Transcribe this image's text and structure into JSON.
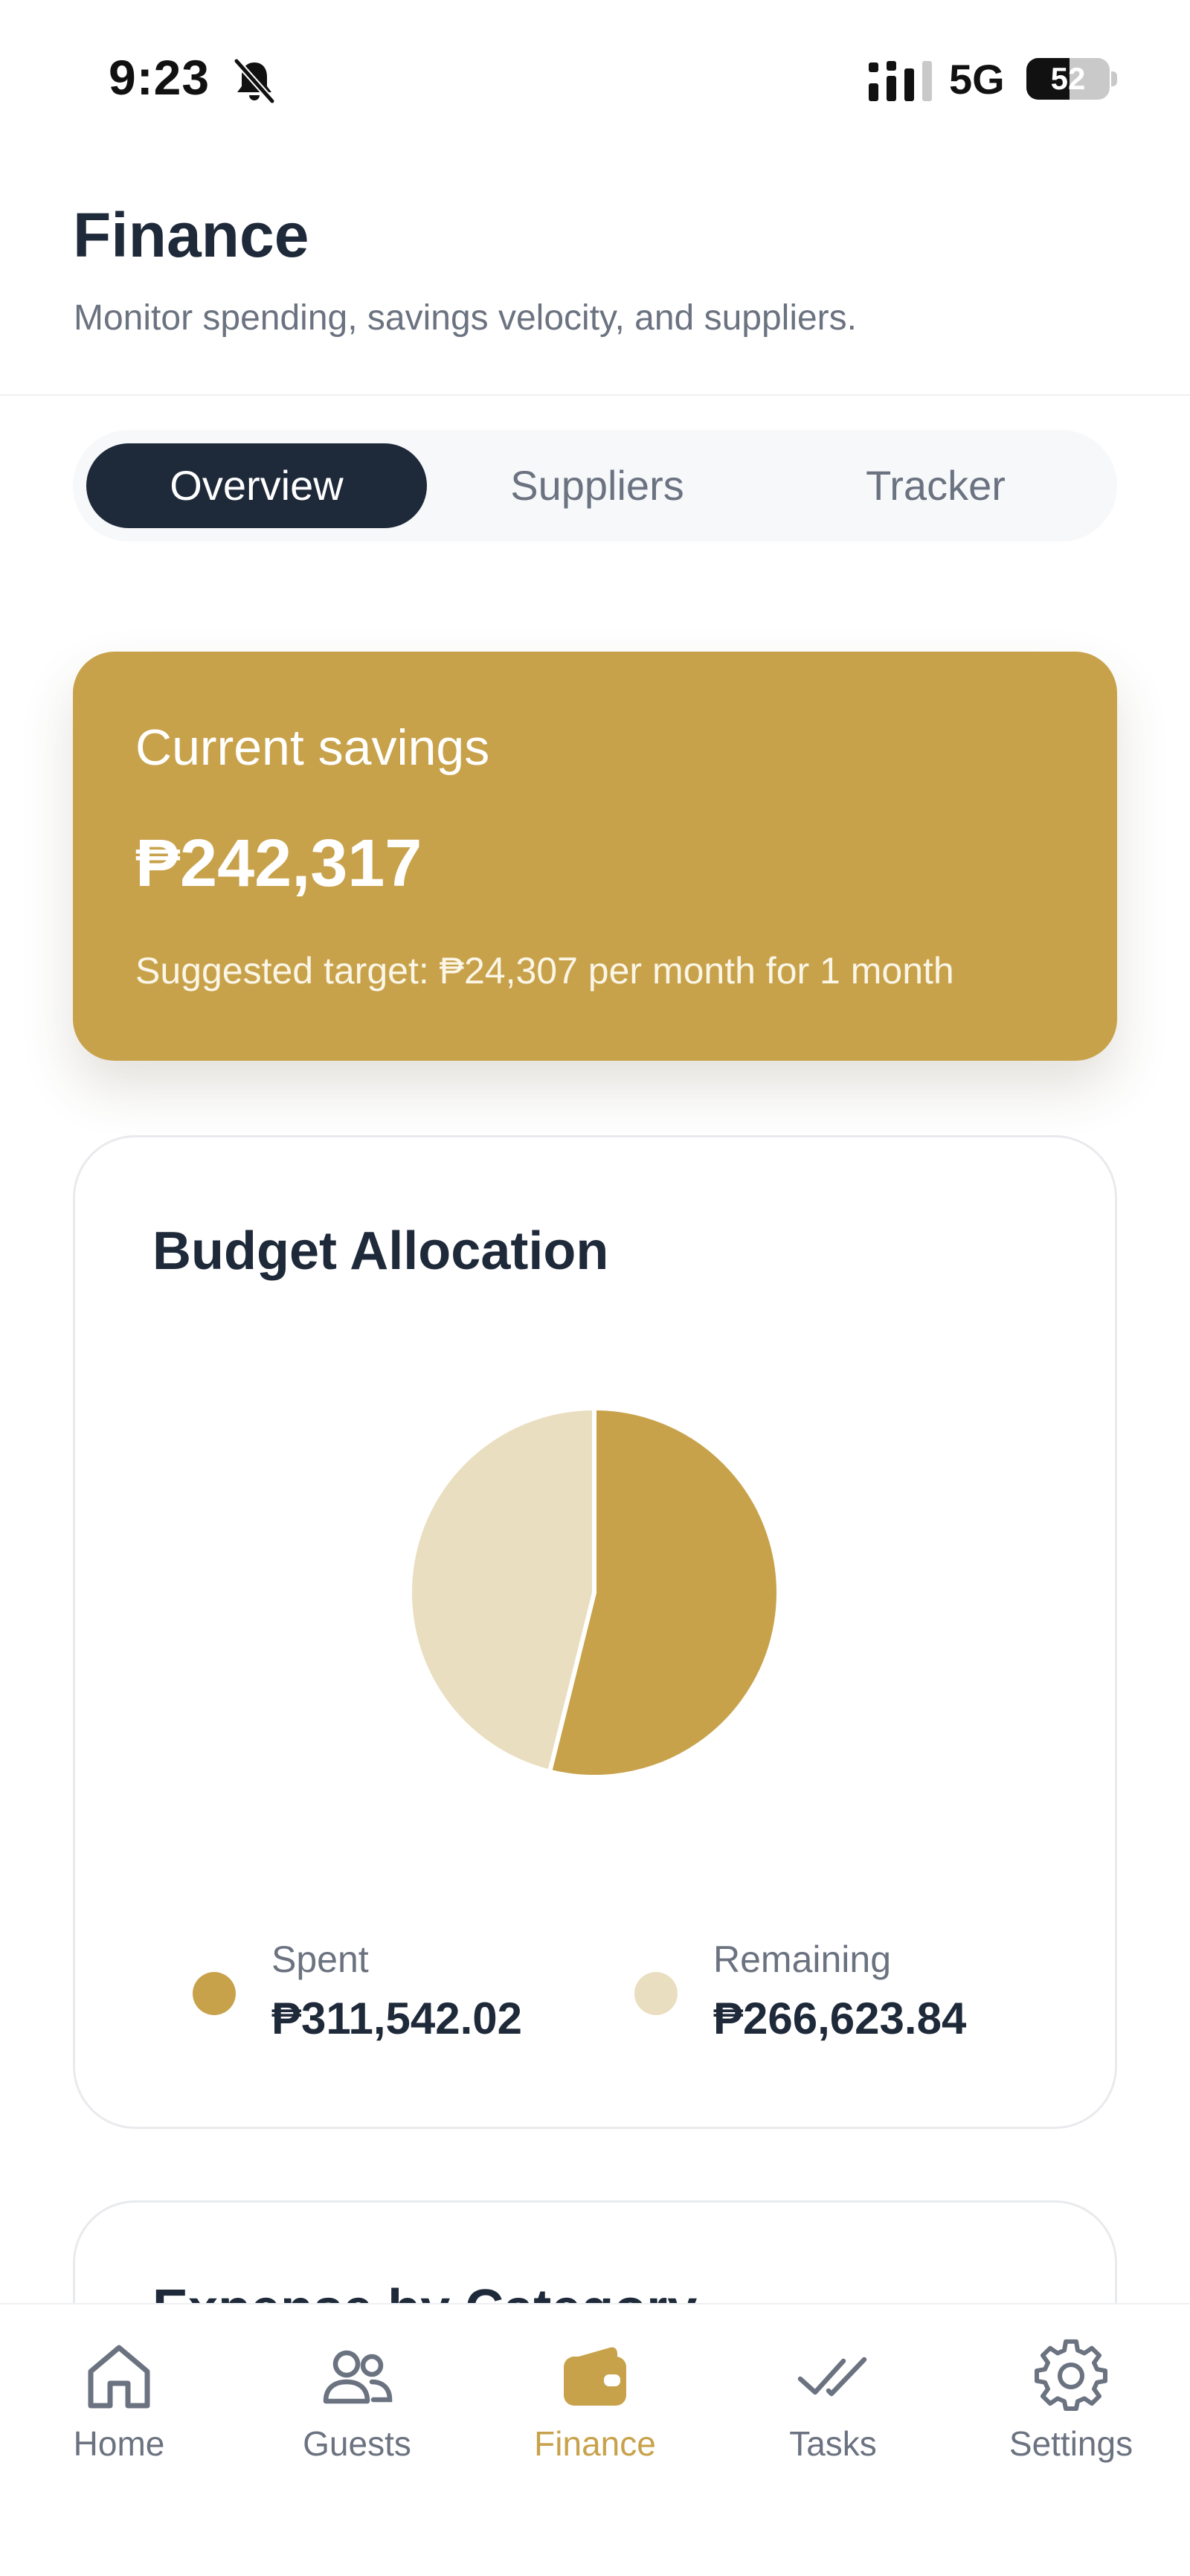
{
  "status_bar": {
    "time": "9:23",
    "network": "5G",
    "battery": "52"
  },
  "header": {
    "title": "Finance",
    "subtitle": "Monitor spending, savings velocity, and suppliers."
  },
  "tabs": [
    {
      "label": "Overview",
      "active": true
    },
    {
      "label": "Suppliers",
      "active": false
    },
    {
      "label": "Tracker",
      "active": false
    }
  ],
  "savings": {
    "label": "Current savings",
    "amount": "₱242,317",
    "target": "Suggested target: ₱24,307 per month for 1 month"
  },
  "budget": {
    "title": "Budget Allocation",
    "legend": [
      {
        "label": "Spent",
        "value": "₱311,542.02",
        "color": "#c8a24b"
      },
      {
        "label": "Remaining",
        "value": "₱266,623.84",
        "color": "#eadec0"
      }
    ]
  },
  "chart_data": {
    "type": "pie",
    "categories": [
      "Spent",
      "Remaining"
    ],
    "values": [
      311542.02,
      266623.84
    ],
    "colors": [
      "#c8a24b",
      "#eadec0"
    ],
    "title": "Budget Allocation"
  },
  "next_card": {
    "title": "Expense by Category"
  },
  "bottom_nav": [
    {
      "label": "Home",
      "icon": "home-icon",
      "active": false
    },
    {
      "label": "Guests",
      "icon": "users-icon",
      "active": false
    },
    {
      "label": "Finance",
      "icon": "wallet-icon",
      "active": true
    },
    {
      "label": "Tasks",
      "icon": "double-check-icon",
      "active": false
    },
    {
      "label": "Settings",
      "icon": "gear-icon",
      "active": false
    }
  ],
  "colors": {
    "accent": "#c8a24b",
    "accent_light": "#eadec0",
    "dark": "#1e2939",
    "muted": "#6b7280"
  }
}
